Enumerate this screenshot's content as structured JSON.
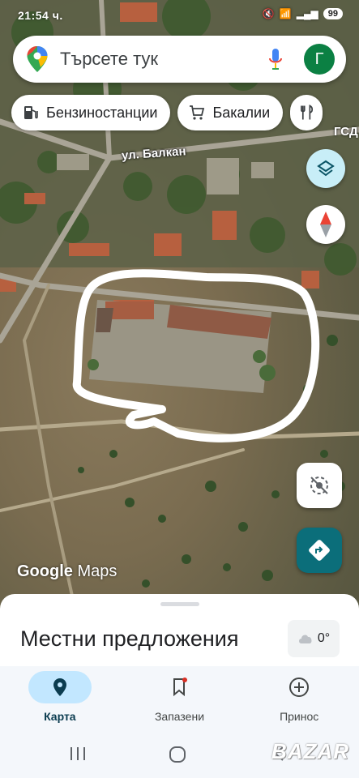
{
  "status_bar": {
    "time": "21:54 ч.",
    "carrier": "ГСД",
    "battery": "99"
  },
  "search": {
    "placeholder": "Търсете тук",
    "avatar_letter": "Г"
  },
  "chips": [
    {
      "label": "Бензиностанции",
      "icon": "gas-station-icon"
    },
    {
      "label": "Бакалии",
      "icon": "cart-icon"
    },
    {
      "label": "",
      "icon": "restaurant-icon"
    }
  ],
  "map": {
    "street_label": "ул. Балкан",
    "town_label": "ГСД",
    "attribution_brand": "Google",
    "attribution_product": "Maps"
  },
  "sheet": {
    "title": "Местни предложения",
    "weather": "0°"
  },
  "nav": [
    {
      "label": "Карта",
      "icon": "explore-pin-icon",
      "active": true
    },
    {
      "label": "Запазени",
      "icon": "bookmark-icon",
      "active": false
    },
    {
      "label": "Принос",
      "icon": "add-circle-icon",
      "active": false
    }
  ],
  "watermark": "BAZAR",
  "colors": {
    "accent": "#0b6e7a",
    "active_pill": "#c2e7ff",
    "avatar": "#0b8043"
  }
}
